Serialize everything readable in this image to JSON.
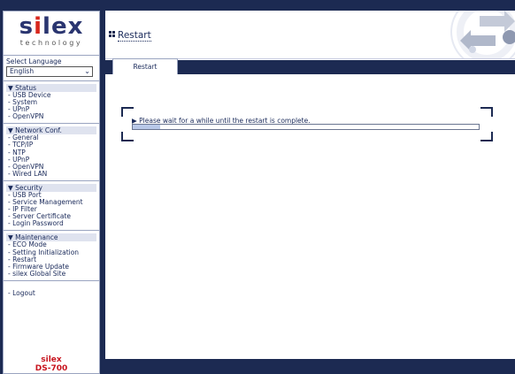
{
  "sidebar": {
    "logo": {
      "brand_a": "s",
      "brand_i": "i",
      "brand_b": "lex",
      "sub": "technology"
    },
    "language": {
      "label": "Select Language",
      "value": "English"
    },
    "sections": [
      {
        "header": "▼ Status",
        "items": [
          "- USB Device",
          "- System",
          "- UPnP",
          "- OpenVPN"
        ]
      },
      {
        "header": "▼ Network Conf.",
        "items": [
          "- General",
          "- TCP/IP",
          "- NTP",
          "- UPnP",
          "- OpenVPN",
          "- Wired LAN"
        ]
      },
      {
        "header": "▼ Security",
        "items": [
          "- USB Port",
          "- Service Management",
          "- IP Filter",
          "- Server Certificate",
          "- Login Password"
        ]
      },
      {
        "header": "▼ Maintenance",
        "items": [
          "- ECO Mode",
          "- Setting Initialization",
          "- Restart",
          "- Firmware Update",
          "- silex Global Site"
        ]
      }
    ],
    "logout": "- Logout",
    "model": {
      "line1": "silex",
      "line2": "DS-700"
    }
  },
  "header": {
    "title": "Restart"
  },
  "tabs": [
    {
      "label": "Restart"
    }
  ],
  "content": {
    "message": "▶ Please wait for a while until the restart is complete.",
    "progress_fraction": 0.08
  },
  "colors": {
    "navy": "#1c2a52",
    "brand_red": "#d8281e",
    "progress_fill": "#b8c8e8"
  }
}
